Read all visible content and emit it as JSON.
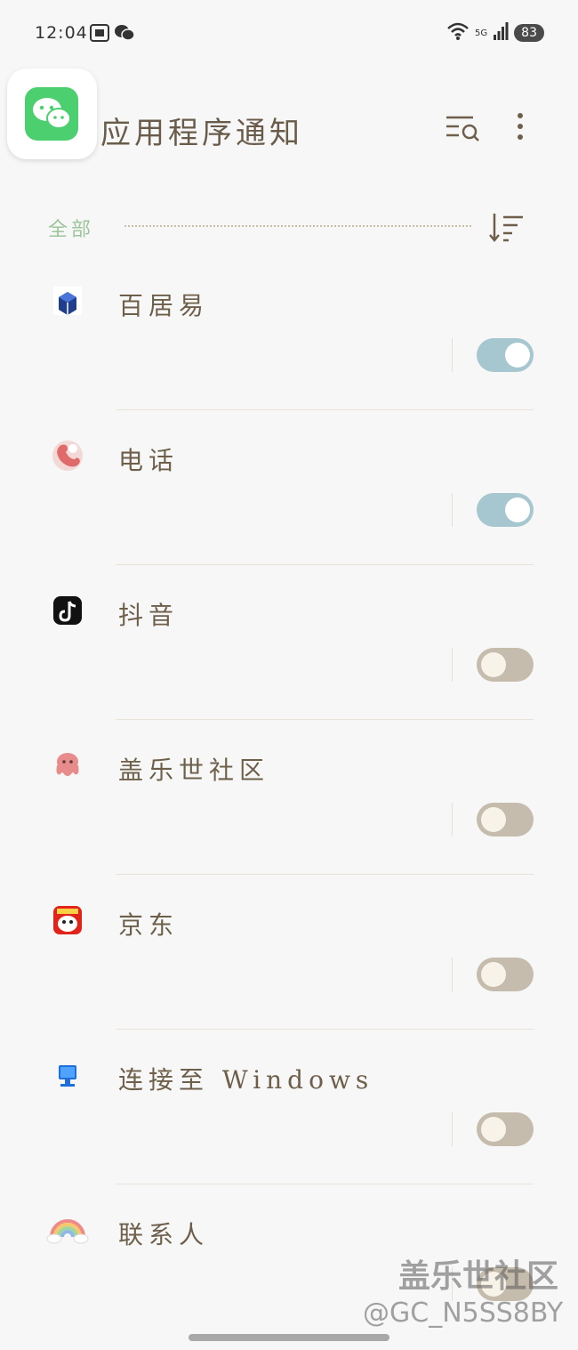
{
  "status_bar": {
    "time": "12:04",
    "network": "5G",
    "battery": "83"
  },
  "header": {
    "title": "应用程序通知"
  },
  "filter": {
    "label": "全部"
  },
  "apps": [
    {
      "name": "百居易",
      "enabled": true,
      "icon": "baijuyi-icon"
    },
    {
      "name": "电话",
      "enabled": true,
      "icon": "phone-icon"
    },
    {
      "name": "抖音",
      "enabled": false,
      "icon": "douyin-icon"
    },
    {
      "name": "盖乐世社区",
      "enabled": false,
      "icon": "octopus-icon"
    },
    {
      "name": "京东",
      "enabled": false,
      "icon": "jd-icon"
    },
    {
      "name": "连接至 Windows",
      "enabled": false,
      "icon": "computer-icon"
    },
    {
      "name": "联系人",
      "enabled": false,
      "icon": "rainbow-icon"
    }
  ],
  "watermark": {
    "line1": "盖乐世社区",
    "line2": "@GC_N5SS8BY"
  },
  "colors": {
    "toggle_on": "#a6c6d0",
    "toggle_off": "#c6bcad",
    "filter_label": "#9dc59d",
    "wechat_green": "#4ccf6e"
  }
}
